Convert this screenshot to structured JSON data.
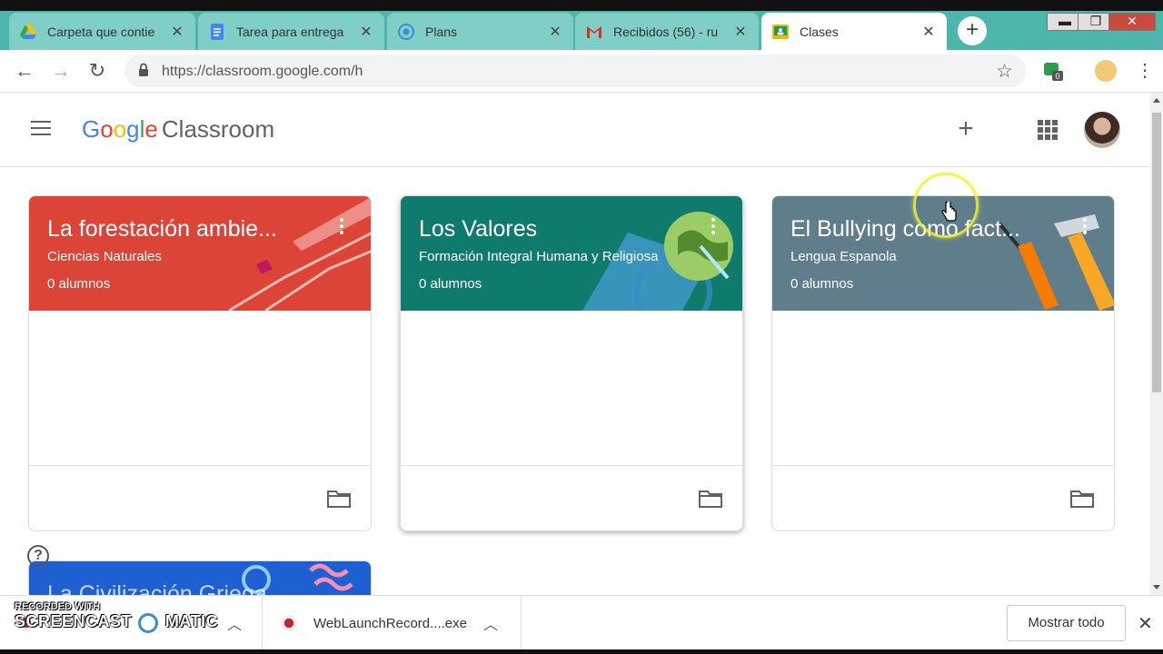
{
  "browser": {
    "tabs": [
      {
        "label": "Carpeta que contie",
        "icon": "google-drive-icon"
      },
      {
        "label": "Tarea para entrega",
        "icon": "google-docs-icon"
      },
      {
        "label": "Plans",
        "icon": "plans-icon"
      },
      {
        "label": "Recibidos (56) - ru",
        "icon": "gmail-icon"
      },
      {
        "label": "Clases",
        "icon": "google-classroom-icon",
        "active": true
      }
    ],
    "url": "https://classroom.google.com/h",
    "extension_badge": "0"
  },
  "app": {
    "logo_google": [
      "G",
      "o",
      "o",
      "g",
      "l",
      "e"
    ],
    "product": "Classroom"
  },
  "classes": [
    {
      "title": "La forestación ambie...",
      "section": "Ciencias Naturales",
      "students": "0 alumnos",
      "color": "#db4437"
    },
    {
      "title": "Los Valores",
      "section": "Formación Integral Humana y Religiosa",
      "students": "0 alumnos",
      "color": "#0f7b6c"
    },
    {
      "title": "El Bullying como fact...",
      "section": "Lengua Espanola",
      "students": "0 alumnos",
      "color": "#607d8b"
    },
    {
      "title": "La Civilización Griega",
      "section": "",
      "students": "",
      "color": "#1e5fd1"
    }
  ],
  "downloads": [
    {
      "name": ""
    },
    {
      "name": "WebLaunchRecord....exe"
    }
  ],
  "shelf": {
    "show_all": "Mostrar todo"
  },
  "watermark": {
    "line1": "RECORDED WITH",
    "line2": "SCREENCAST",
    "line3": "MATIC"
  }
}
